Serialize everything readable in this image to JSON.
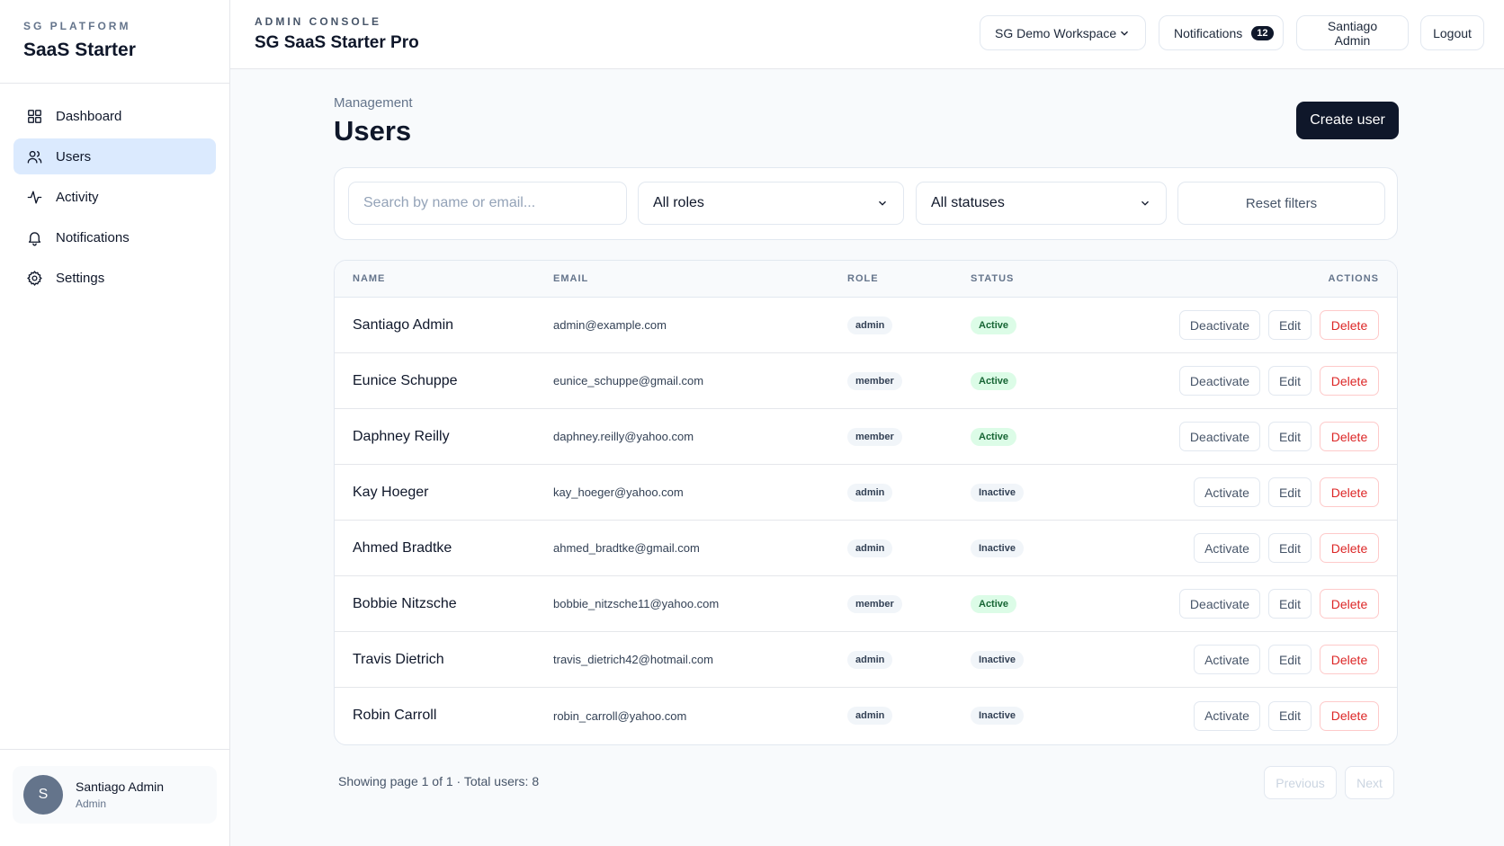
{
  "sidebar": {
    "kicker": "SG PLATFORM",
    "brand": "SaaS Starter",
    "items": [
      {
        "label": "Dashboard",
        "icon": "dashboard-icon"
      },
      {
        "label": "Users",
        "icon": "users-icon",
        "active": true
      },
      {
        "label": "Activity",
        "icon": "activity-icon"
      },
      {
        "label": "Notifications",
        "icon": "bell-icon"
      },
      {
        "label": "Settings",
        "icon": "gear-icon"
      }
    ],
    "user": {
      "initial": "S",
      "name": "Santiago Admin",
      "role": "Admin"
    }
  },
  "header": {
    "kicker": "ADMIN CONSOLE",
    "title": "SG SaaS Starter Pro",
    "workspace": "SG Demo Workspace",
    "notifications_label": "Notifications",
    "notifications_count": "12",
    "account": "Santiago Admin",
    "logout": "Logout"
  },
  "main": {
    "breadcrumb": "Management",
    "title": "Users",
    "create_button": "Create user",
    "filters": {
      "search_placeholder": "Search by name or email...",
      "role_value": "All roles",
      "status_value": "All statuses",
      "reset": "Reset filters"
    },
    "table": {
      "columns": {
        "name": "NAME",
        "email": "EMAIL",
        "role": "ROLE",
        "status": "STATUS",
        "actions": "ACTIONS"
      },
      "rows": [
        {
          "name": "Santiago Admin",
          "email": "admin@example.com",
          "role": "admin",
          "status": "Active",
          "toggle": "Deactivate",
          "edit": "Edit",
          "delete": "Delete"
        },
        {
          "name": "Eunice Schuppe",
          "email": "eunice_schuppe@gmail.com",
          "role": "member",
          "status": "Active",
          "toggle": "Deactivate",
          "edit": "Edit",
          "delete": "Delete"
        },
        {
          "name": "Daphney Reilly",
          "email": "daphney.reilly@yahoo.com",
          "role": "member",
          "status": "Active",
          "toggle": "Deactivate",
          "edit": "Edit",
          "delete": "Delete"
        },
        {
          "name": "Kay Hoeger",
          "email": "kay_hoeger@yahoo.com",
          "role": "admin",
          "status": "Inactive",
          "toggle": "Activate",
          "edit": "Edit",
          "delete": "Delete"
        },
        {
          "name": "Ahmed Bradtke",
          "email": "ahmed_bradtke@gmail.com",
          "role": "admin",
          "status": "Inactive",
          "toggle": "Activate",
          "edit": "Edit",
          "delete": "Delete"
        },
        {
          "name": "Bobbie Nitzsche",
          "email": "bobbie_nitzsche11@yahoo.com",
          "role": "member",
          "status": "Active",
          "toggle": "Deactivate",
          "edit": "Edit",
          "delete": "Delete"
        },
        {
          "name": "Travis Dietrich",
          "email": "travis_dietrich42@hotmail.com",
          "role": "admin",
          "status": "Inactive",
          "toggle": "Activate",
          "edit": "Edit",
          "delete": "Delete"
        },
        {
          "name": "Robin Carroll",
          "email": "robin_carroll@yahoo.com",
          "role": "admin",
          "status": "Inactive",
          "toggle": "Activate",
          "edit": "Edit",
          "delete": "Delete"
        }
      ]
    },
    "pagination": {
      "info": "Showing page 1 of 1 · Total users: 8",
      "previous": "Previous",
      "next": "Next"
    }
  },
  "colors": {
    "primary": "#0f172a",
    "active_nav": "#dbeafe",
    "danger": "#dc2626",
    "success_bg": "#dcfce7",
    "success_text": "#166534"
  }
}
